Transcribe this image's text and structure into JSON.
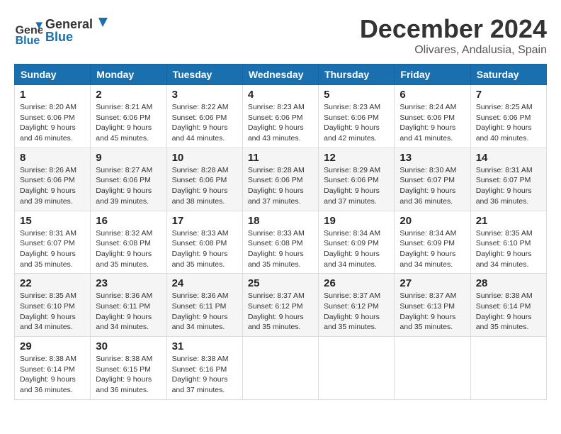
{
  "logo": {
    "line1": "General",
    "line2": "Blue"
  },
  "title": "December 2024",
  "location": "Olivares, Andalusia, Spain",
  "weekdays": [
    "Sunday",
    "Monday",
    "Tuesday",
    "Wednesday",
    "Thursday",
    "Friday",
    "Saturday"
  ],
  "weeks": [
    [
      {
        "day": "1",
        "sunrise": "8:20 AM",
        "sunset": "6:06 PM",
        "daylight": "9 hours and 46 minutes."
      },
      {
        "day": "2",
        "sunrise": "8:21 AM",
        "sunset": "6:06 PM",
        "daylight": "9 hours and 45 minutes."
      },
      {
        "day": "3",
        "sunrise": "8:22 AM",
        "sunset": "6:06 PM",
        "daylight": "9 hours and 44 minutes."
      },
      {
        "day": "4",
        "sunrise": "8:23 AM",
        "sunset": "6:06 PM",
        "daylight": "9 hours and 43 minutes."
      },
      {
        "day": "5",
        "sunrise": "8:23 AM",
        "sunset": "6:06 PM",
        "daylight": "9 hours and 42 minutes."
      },
      {
        "day": "6",
        "sunrise": "8:24 AM",
        "sunset": "6:06 PM",
        "daylight": "9 hours and 41 minutes."
      },
      {
        "day": "7",
        "sunrise": "8:25 AM",
        "sunset": "6:06 PM",
        "daylight": "9 hours and 40 minutes."
      }
    ],
    [
      {
        "day": "8",
        "sunrise": "8:26 AM",
        "sunset": "6:06 PM",
        "daylight": "9 hours and 39 minutes."
      },
      {
        "day": "9",
        "sunrise": "8:27 AM",
        "sunset": "6:06 PM",
        "daylight": "9 hours and 39 minutes."
      },
      {
        "day": "10",
        "sunrise": "8:28 AM",
        "sunset": "6:06 PM",
        "daylight": "9 hours and 38 minutes."
      },
      {
        "day": "11",
        "sunrise": "8:28 AM",
        "sunset": "6:06 PM",
        "daylight": "9 hours and 37 minutes."
      },
      {
        "day": "12",
        "sunrise": "8:29 AM",
        "sunset": "6:06 PM",
        "daylight": "9 hours and 37 minutes."
      },
      {
        "day": "13",
        "sunrise": "8:30 AM",
        "sunset": "6:07 PM",
        "daylight": "9 hours and 36 minutes."
      },
      {
        "day": "14",
        "sunrise": "8:31 AM",
        "sunset": "6:07 PM",
        "daylight": "9 hours and 36 minutes."
      }
    ],
    [
      {
        "day": "15",
        "sunrise": "8:31 AM",
        "sunset": "6:07 PM",
        "daylight": "9 hours and 35 minutes."
      },
      {
        "day": "16",
        "sunrise": "8:32 AM",
        "sunset": "6:08 PM",
        "daylight": "9 hours and 35 minutes."
      },
      {
        "day": "17",
        "sunrise": "8:33 AM",
        "sunset": "6:08 PM",
        "daylight": "9 hours and 35 minutes."
      },
      {
        "day": "18",
        "sunrise": "8:33 AM",
        "sunset": "6:08 PM",
        "daylight": "9 hours and 35 minutes."
      },
      {
        "day": "19",
        "sunrise": "8:34 AM",
        "sunset": "6:09 PM",
        "daylight": "9 hours and 34 minutes."
      },
      {
        "day": "20",
        "sunrise": "8:34 AM",
        "sunset": "6:09 PM",
        "daylight": "9 hours and 34 minutes."
      },
      {
        "day": "21",
        "sunrise": "8:35 AM",
        "sunset": "6:10 PM",
        "daylight": "9 hours and 34 minutes."
      }
    ],
    [
      {
        "day": "22",
        "sunrise": "8:35 AM",
        "sunset": "6:10 PM",
        "daylight": "9 hours and 34 minutes."
      },
      {
        "day": "23",
        "sunrise": "8:36 AM",
        "sunset": "6:11 PM",
        "daylight": "9 hours and 34 minutes."
      },
      {
        "day": "24",
        "sunrise": "8:36 AM",
        "sunset": "6:11 PM",
        "daylight": "9 hours and 34 minutes."
      },
      {
        "day": "25",
        "sunrise": "8:37 AM",
        "sunset": "6:12 PM",
        "daylight": "9 hours and 35 minutes."
      },
      {
        "day": "26",
        "sunrise": "8:37 AM",
        "sunset": "6:12 PM",
        "daylight": "9 hours and 35 minutes."
      },
      {
        "day": "27",
        "sunrise": "8:37 AM",
        "sunset": "6:13 PM",
        "daylight": "9 hours and 35 minutes."
      },
      {
        "day": "28",
        "sunrise": "8:38 AM",
        "sunset": "6:14 PM",
        "daylight": "9 hours and 35 minutes."
      }
    ],
    [
      {
        "day": "29",
        "sunrise": "8:38 AM",
        "sunset": "6:14 PM",
        "daylight": "9 hours and 36 minutes."
      },
      {
        "day": "30",
        "sunrise": "8:38 AM",
        "sunset": "6:15 PM",
        "daylight": "9 hours and 36 minutes."
      },
      {
        "day": "31",
        "sunrise": "8:38 AM",
        "sunset": "6:16 PM",
        "daylight": "9 hours and 37 minutes."
      },
      null,
      null,
      null,
      null
    ]
  ]
}
